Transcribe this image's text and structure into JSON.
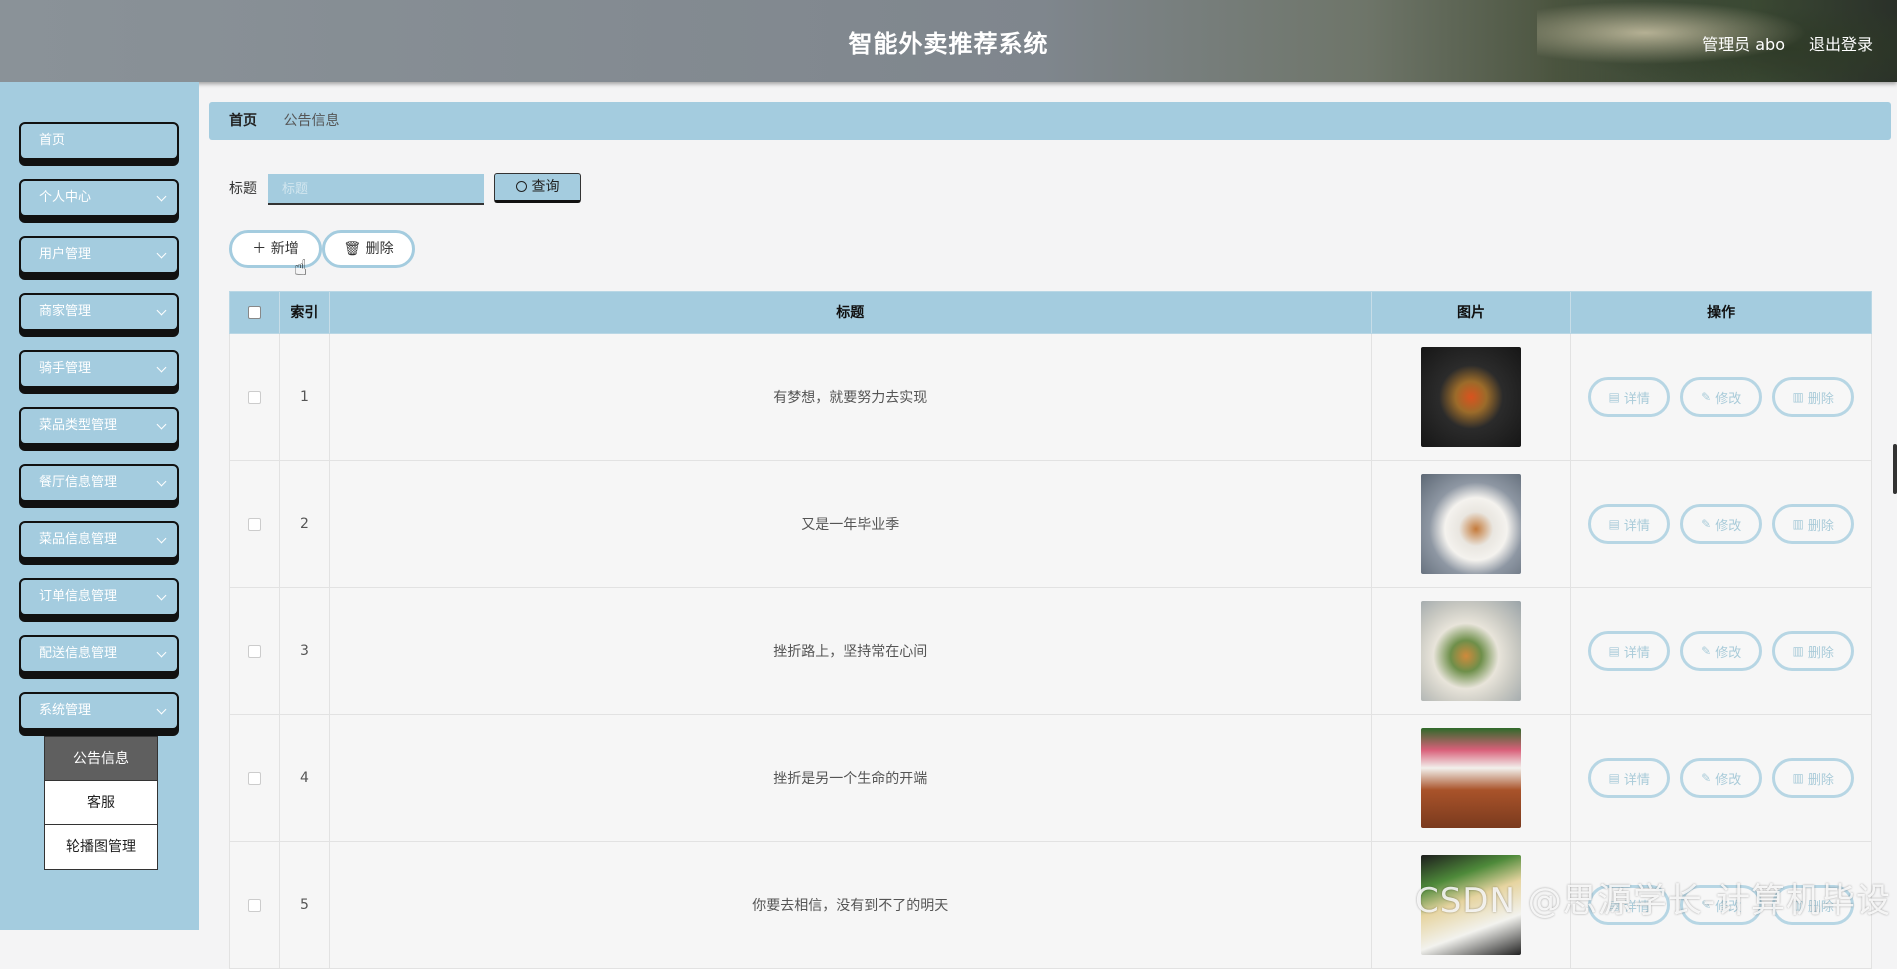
{
  "header": {
    "title": "智能外卖推荐系统",
    "admin_label": "管理员 abo",
    "logout_label": "退出登录"
  },
  "sidebar": {
    "items": [
      {
        "label": "首页",
        "has_arrow": false
      },
      {
        "label": "个人中心",
        "has_arrow": true
      },
      {
        "label": "用户管理",
        "has_arrow": true
      },
      {
        "label": "商家管理",
        "has_arrow": true
      },
      {
        "label": "骑手管理",
        "has_arrow": true
      },
      {
        "label": "菜品类型管理",
        "has_arrow": true
      },
      {
        "label": "餐厅信息管理",
        "has_arrow": true
      },
      {
        "label": "菜品信息管理",
        "has_arrow": true
      },
      {
        "label": "订单信息管理",
        "has_arrow": true
      },
      {
        "label": "配送信息管理",
        "has_arrow": true
      },
      {
        "label": "系统管理",
        "has_arrow": true
      }
    ],
    "submenu": [
      {
        "label": "公告信息",
        "active": true
      },
      {
        "label": "客服",
        "active": false
      },
      {
        "label": "轮播图管理",
        "active": false
      }
    ]
  },
  "breadcrumb": {
    "home": "首页",
    "current": "公告信息"
  },
  "search": {
    "label": "标题",
    "placeholder": "标题",
    "value": "",
    "button_label": "查询"
  },
  "actions": {
    "add_label": "新增",
    "delete_label": "删除"
  },
  "table": {
    "columns": [
      "索引",
      "标题",
      "图片",
      "操作"
    ],
    "rows": [
      {
        "index": "1",
        "title": "有梦想，就要努力去实现",
        "image": "dish-photo-1"
      },
      {
        "index": "2",
        "title": "又是一年毕业季",
        "image": "dish-photo-2"
      },
      {
        "index": "3",
        "title": "挫折路上，坚持常在心间",
        "image": "dish-photo-3"
      },
      {
        "index": "4",
        "title": "挫折是另一个生命的开端",
        "image": "dish-photo-4"
      },
      {
        "index": "5",
        "title": "你要去相信，没有到不了的明天",
        "image": "dish-photo-5"
      }
    ],
    "row_actions": {
      "detail": "详情",
      "edit": "修改",
      "delete": "删除"
    }
  },
  "watermark": "CSDN @思源学长-计算机毕设",
  "colors": {
    "accent": "#a4ccdf",
    "header": "#7f868d",
    "active_submenu": "#5f5f5f"
  }
}
